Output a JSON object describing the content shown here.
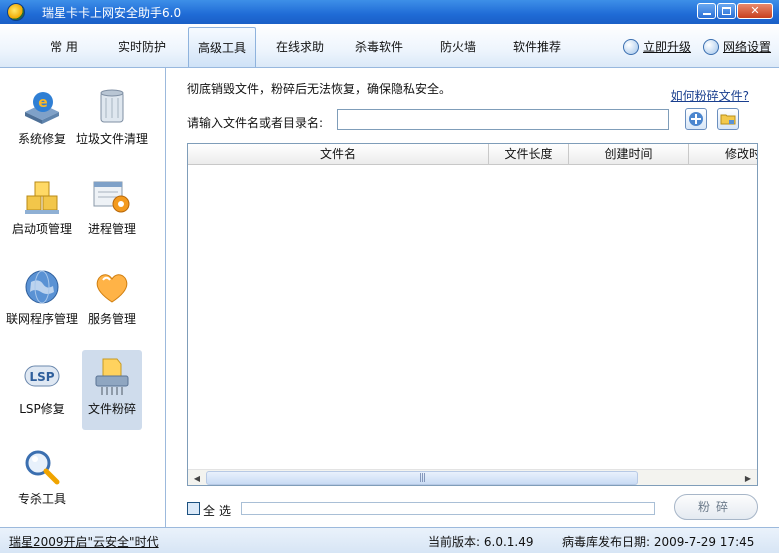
{
  "window": {
    "title": "瑞星卡卡上网安全助手6.0"
  },
  "tabs": [
    {
      "label": "常 用",
      "active": false
    },
    {
      "label": "实时防护",
      "active": false
    },
    {
      "label": "高级工具",
      "active": true
    },
    {
      "label": "在线求助",
      "active": false
    },
    {
      "label": "杀毒软件",
      "active": false
    },
    {
      "label": "防火墙",
      "active": false
    },
    {
      "label": "软件推荐",
      "active": false
    }
  ],
  "toolbar_links": {
    "upgrade": "立即升级",
    "network_settings": "网络设置"
  },
  "sidebar": {
    "items": [
      {
        "label": "系统修复",
        "icon": "system-repair-icon"
      },
      {
        "label": "垃圾文件清理",
        "icon": "trash-clean-icon"
      },
      {
        "label": "启动项管理",
        "icon": "startup-manager-icon"
      },
      {
        "label": "进程管理",
        "icon": "process-manager-icon"
      },
      {
        "label": "联网程序管理",
        "icon": "network-program-icon"
      },
      {
        "label": "服务管理",
        "icon": "service-manager-icon"
      },
      {
        "label": "LSP修复",
        "icon": "lsp-repair-icon"
      },
      {
        "label": "文件粉碎",
        "icon": "file-shredder-icon",
        "selected": true
      },
      {
        "label": "专杀工具",
        "icon": "special-kill-tool-icon"
      }
    ]
  },
  "main": {
    "description": "彻底销毁文件，粉碎后无法恢复，确保隐私安全。",
    "howto_link": "如何粉碎文件?",
    "input_label": "请输入文件名或者目录名:",
    "input_value": "",
    "columns": [
      "文件名",
      "文件长度",
      "创建时间",
      "修改时"
    ],
    "rows": [],
    "select_all_label": "全选",
    "shred_button": "粉碎"
  },
  "status": {
    "promo": "瑞星2009开启\"云安全\"时代",
    "version_label": "当前版本:",
    "version": "6.0.1.49",
    "db_date_label": "病毒库发布日期:",
    "db_date": "2009-7-29 17:45"
  },
  "colors": {
    "titlebar": "#1f6bd6",
    "accent": "#3d8fe8",
    "selected_item": "#cfdcec"
  }
}
